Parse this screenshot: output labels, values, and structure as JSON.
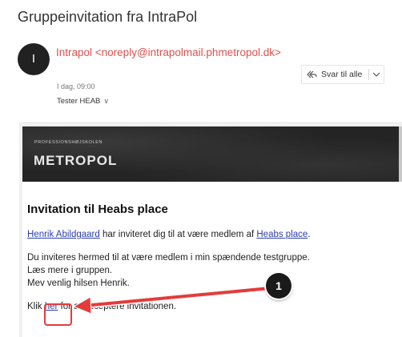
{
  "email": {
    "subject": "Gruppeinvitation fra IntraPol",
    "avatar_initial": "I",
    "sender": "Intrapol <noreply@intrapolmail.phmetropol.dk>",
    "date": "I dag, 09:00",
    "recipient": "Tester HEAB",
    "reply_all_label": "Svar til alle"
  },
  "banner": {
    "institution": "PROFESSIONSHØJSKOLEN",
    "logo_text": "METROPOL"
  },
  "message": {
    "heading": "Invitation til Heabs place",
    "inviter_link": "Henrik Abildgaard",
    "invite_text_mid": " har inviteret dig til at være medlem af ",
    "place_link": "Heabs place",
    "invite_text_end": ".",
    "line1": "Du inviteres hermed til at være medlem i min spændende testgruppe.",
    "line2": "Læs mere i gruppen.",
    "line3": "Mev venlig hilsen Henrik.",
    "click_prefix": "Klik ",
    "click_link": "her",
    "click_suffix": " for at acceptere invitationen."
  },
  "annotation": {
    "step_number": "1",
    "color": "#e53b3b"
  }
}
